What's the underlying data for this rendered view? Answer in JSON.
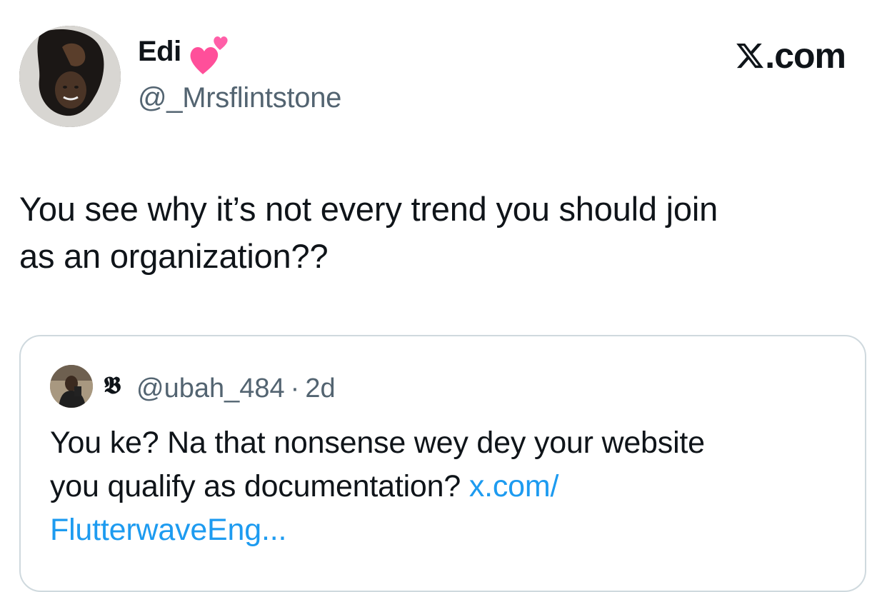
{
  "author": {
    "display_name": "Edi",
    "handle": "@_Mrsflintstone",
    "emoji_icon": "two-hearts-icon"
  },
  "brand": {
    "logo_icon": "x-logo-icon",
    "suffix": ".com"
  },
  "tweet": {
    "line1": "You see why it’s not every trend you should join",
    "line2": "as an organization??"
  },
  "quoted_tweet": {
    "badge_glyph": "𝕭",
    "handle": "@ubah_484",
    "separator": "·",
    "time": "2d",
    "text_line1": "You ke? Na that nonsense wey dey your website",
    "text_line2": "you qualify as documentation?",
    "link_part1": "x.com/",
    "link_part2": "FlutterwaveEng..."
  },
  "colors": {
    "text_primary": "#0f1419",
    "text_secondary": "#536471",
    "link": "#1d9bf0",
    "border": "#cfd9de",
    "heart": "#ff4f9a"
  }
}
